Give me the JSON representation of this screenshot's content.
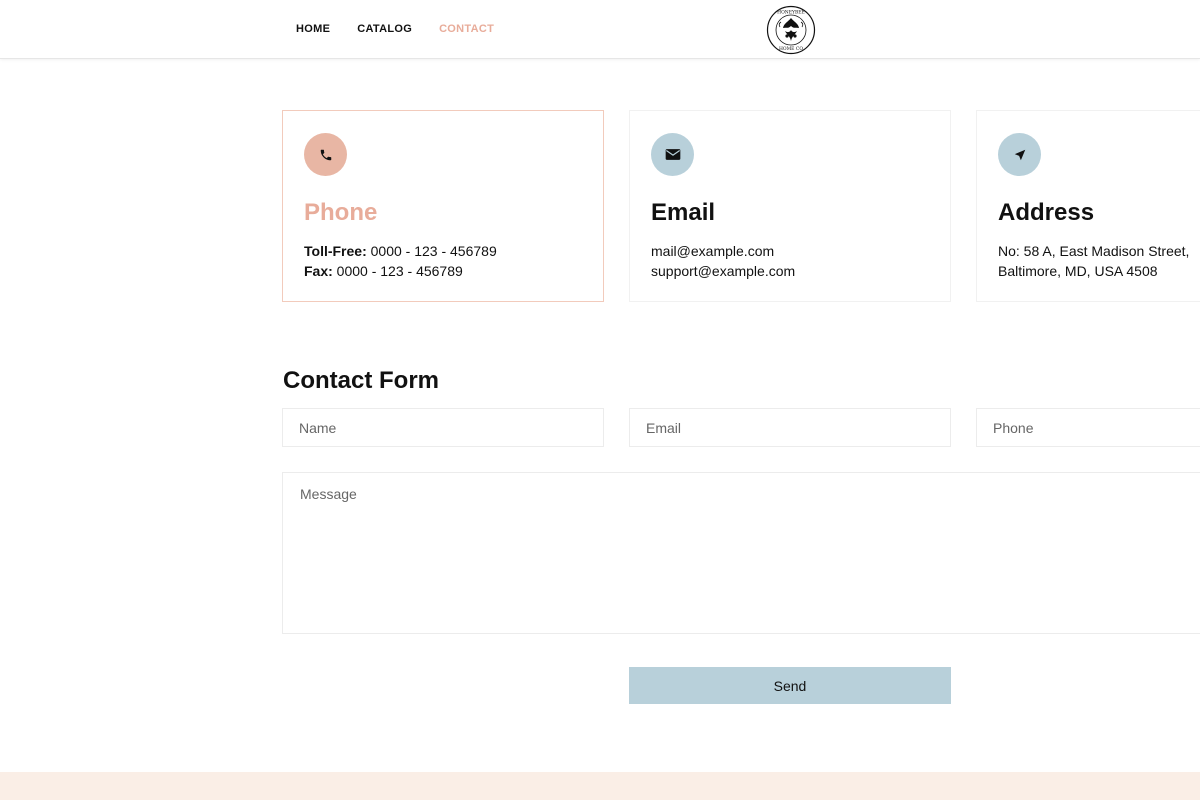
{
  "nav": {
    "items": [
      {
        "label": "HOME",
        "active": false
      },
      {
        "label": "CATALOG",
        "active": false
      },
      {
        "label": "CONTACT",
        "active": true
      }
    ]
  },
  "logo": {
    "text": "THE HONEYBEE HOME COMPANY"
  },
  "cards": {
    "phone": {
      "icon": "phone-icon",
      "title": "Phone",
      "toll_free_label": "Toll-Free:",
      "toll_free_value": " 0000 - 123 - 456789",
      "fax_label": "Fax:",
      "fax_value": " 0000 - 123 - 456789"
    },
    "email": {
      "icon": "envelope-icon",
      "title": "Email",
      "line1": "mail@example.com",
      "line2": "support@example.com"
    },
    "address": {
      "icon": "location-arrow-icon",
      "title": "Address",
      "line1": "No: 58 A, East Madison Street,",
      "line2": "Baltimore, MD, USA 4508"
    }
  },
  "form": {
    "title": "Contact Form",
    "name_placeholder": "Name",
    "email_placeholder": "Email",
    "phone_placeholder": "Phone",
    "message_placeholder": "Message",
    "send_label": "Send"
  },
  "colors": {
    "accent_peach": "#e8ac9a",
    "accent_blue": "#b8d0da",
    "footer_band": "#faeee6"
  }
}
